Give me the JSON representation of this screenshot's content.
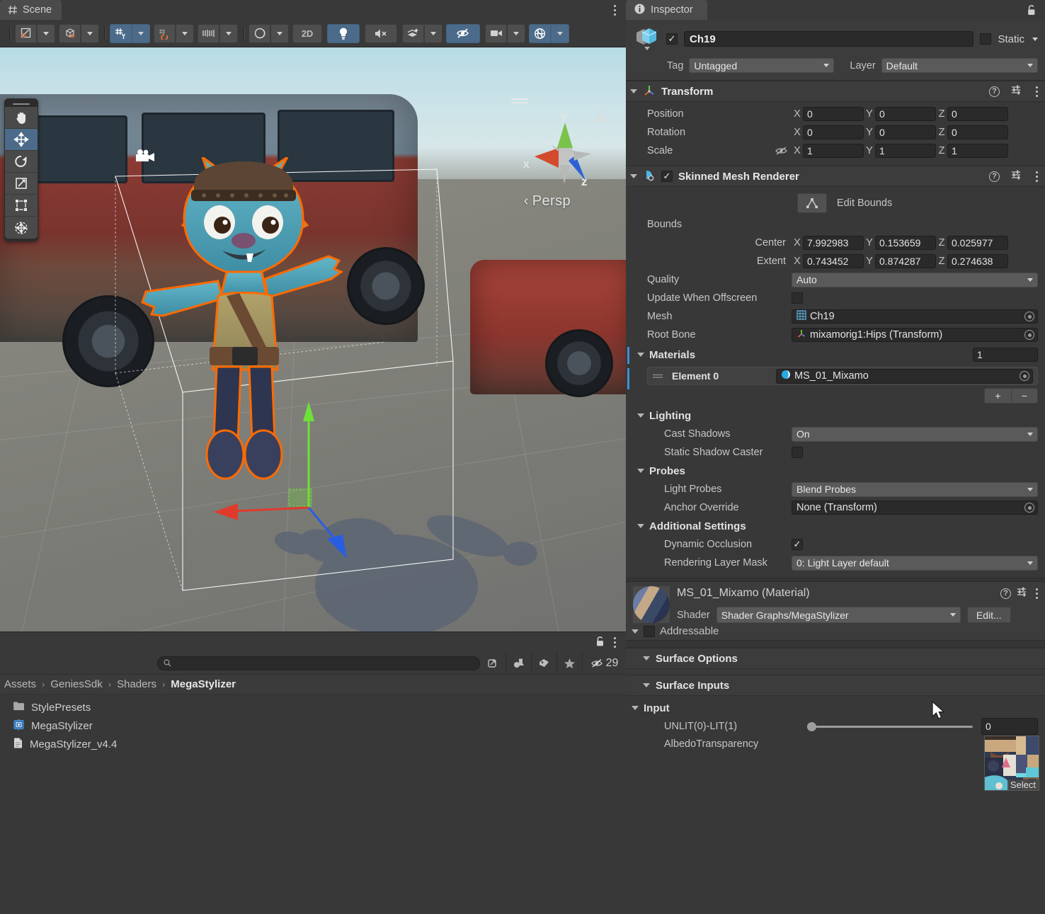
{
  "scene_panel": {
    "tab_label": "Scene",
    "tab_icon": "grid-icon",
    "toolbar": {
      "buttons": [
        {
          "name": "pivot-mode",
          "icon": "pivot-icon",
          "active": false
        },
        {
          "name": "pivot-rotation",
          "icon": "cube-icon",
          "active": false
        },
        {
          "name": "grid-snapping",
          "icon": "grid-axis-icon",
          "active": true
        },
        {
          "name": "vertex-snapping",
          "icon": "magnet-icon",
          "active": false
        },
        {
          "name": "grid-size",
          "icon": "ruler-icon",
          "active": false
        },
        {
          "name": "scene-view-mode",
          "icon": "shading-sphere-icon",
          "active": false
        },
        {
          "name": "toggle-2d",
          "label": "2D",
          "active": false
        },
        {
          "name": "toggle-lighting",
          "icon": "lightbulb-icon",
          "active": true
        },
        {
          "name": "toggle-audio",
          "icon": "mute-icon",
          "active": false
        },
        {
          "name": "scene-fx",
          "icon": "fx-layers-icon",
          "active": false
        },
        {
          "name": "toggle-hidden",
          "icon": "eye-slash-icon",
          "active": true
        },
        {
          "name": "camera-settings",
          "icon": "camera-icon",
          "active": false
        },
        {
          "name": "gizmos-toggle",
          "icon": "gizmo-globe-icon",
          "active": true
        }
      ]
    },
    "tools": [
      {
        "name": "hand-tool",
        "icon": "hand-icon",
        "active": false
      },
      {
        "name": "move-tool",
        "icon": "move-arrows-icon",
        "active": true
      },
      {
        "name": "rotate-tool",
        "icon": "rotate-icon",
        "active": false
      },
      {
        "name": "scale-tool",
        "icon": "scale-icon",
        "active": false
      },
      {
        "name": "rect-tool",
        "icon": "rect-transform-icon",
        "active": false
      },
      {
        "name": "transform-tool",
        "icon": "combined-transform-icon",
        "active": false
      }
    ],
    "gizmo": {
      "x_label": "x",
      "y_label": "y",
      "z_label": "z",
      "projection_label": "Persp",
      "projection_prefix": "‹"
    }
  },
  "project_panel": {
    "search": {
      "placeholder": "",
      "value": ""
    },
    "toolbar_icons": [
      {
        "name": "search-expand-icon"
      },
      {
        "name": "asset-type-filter-icon"
      },
      {
        "name": "label-filter-icon"
      },
      {
        "name": "favorites-icon"
      },
      {
        "name": "hidden-packages-icon"
      }
    ],
    "hidden_count": "29",
    "breadcrumb": [
      "Assets",
      "GeniesSdk",
      "Shaders",
      "MegaStylizer"
    ],
    "breadcrumb_separator": "›",
    "files": [
      {
        "name": "StylePresets",
        "icon": "folder-icon",
        "type": "folder"
      },
      {
        "name": "MegaStylizer",
        "icon": "shadergraph-icon",
        "type": "shadergraph"
      },
      {
        "name": "MegaStylizer_v4.4",
        "icon": "text-file-icon",
        "type": "textfile"
      }
    ]
  },
  "inspector": {
    "tab_label": "Inspector",
    "tab_icon": "info-icon",
    "lock_icon": "lock-open-icon",
    "object": {
      "enabled": true,
      "name": "Ch19",
      "static_label": "Static",
      "static_checked": false,
      "tag_label": "Tag",
      "tag_value": "Untagged",
      "layer_label": "Layer",
      "layer_value": "Default"
    },
    "transform": {
      "title": "Transform",
      "icon": "transform-axis-icon",
      "expanded": true,
      "rows": [
        {
          "label": "Position",
          "x": "0",
          "y": "0",
          "z": "0"
        },
        {
          "label": "Rotation",
          "x": "0",
          "y": "0",
          "z": "0"
        },
        {
          "label": "Scale",
          "x": "1",
          "y": "1",
          "z": "1",
          "extra_icon": "constrain-proportions-off-icon"
        }
      ]
    },
    "skinned_mesh_renderer": {
      "title": "Skinned Mesh Renderer",
      "icon": "skinned-mesh-icon",
      "enabled": true,
      "edit_bounds_label": "Edit Bounds",
      "edit_bounds_icon": "edit-bounds-icon",
      "bounds_label": "Bounds",
      "center": {
        "label": "Center",
        "x": "7.992983",
        "y": "0.153659",
        "z": "0.025977"
      },
      "extent": {
        "label": "Extent",
        "x": "0.743452",
        "y": "0.874287",
        "z": "0.274638"
      },
      "quality": {
        "label": "Quality",
        "value": "Auto"
      },
      "update_when_offscreen": {
        "label": "Update When Offscreen",
        "checked": false
      },
      "mesh": {
        "label": "Mesh",
        "value": "Ch19",
        "icon": "mesh-icon"
      },
      "root_bone": {
        "label": "Root Bone",
        "value": "mixamorig1:Hips (Transform)",
        "icon": "transform-axis-icon"
      },
      "materials": {
        "label": "Materials",
        "count": "1",
        "elements": [
          {
            "label": "Element 0",
            "value": "MS_01_Mixamo",
            "icon": "material-sphere-icon"
          }
        ],
        "add_label": "+",
        "remove_label": "−"
      },
      "lighting": {
        "label": "Lighting",
        "cast_shadows": {
          "label": "Cast Shadows",
          "value": "On"
        },
        "static_shadow_caster": {
          "label": "Static Shadow Caster",
          "checked": false
        }
      },
      "probes": {
        "label": "Probes",
        "light_probes": {
          "label": "Light Probes",
          "value": "Blend Probes"
        },
        "anchor_override": {
          "label": "Anchor Override",
          "value": "None (Transform)"
        }
      },
      "additional_settings": {
        "label": "Additional Settings",
        "dynamic_occlusion": {
          "label": "Dynamic Occlusion",
          "checked": true
        },
        "rendering_layer_mask": {
          "label": "Rendering Layer Mask",
          "value": "0: Light Layer default"
        }
      }
    },
    "material": {
      "title": "MS_01_Mixamo (Material)",
      "shader_label": "Shader",
      "shader_value": "Shader Graphs/MegaStylizer",
      "edit_button": "Edit...",
      "addressable_label": "Addressable",
      "addressable_checked": false,
      "sections": [
        {
          "label": "Surface Options",
          "expanded": true
        },
        {
          "label": "Surface Inputs",
          "expanded": true
        },
        {
          "label": "Input",
          "expanded": true
        }
      ],
      "inputs": {
        "unlit_lit": {
          "label": "UNLIT(0)-LIT(1)",
          "value": "0",
          "slider_pct": 0
        },
        "albedo_transparency": {
          "label": "AlbedoTransparency",
          "select_label": "Select"
        }
      }
    }
  },
  "colors": {
    "accent_blue": "#4c6b8a",
    "selection_outline": "#ff6a00",
    "material_list_bar": "#3f8fd1",
    "panel_bg": "#383838",
    "header_bg": "#3c3c3c"
  }
}
